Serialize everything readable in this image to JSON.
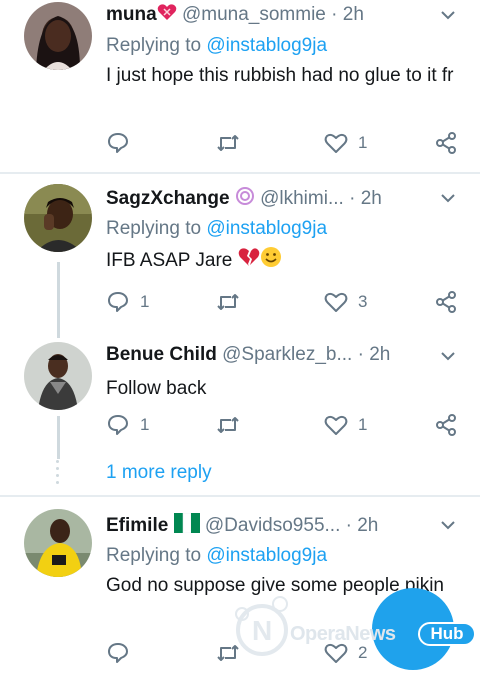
{
  "tweets": [
    {
      "name": "muna",
      "name_emoji": "heart-with-ribbon",
      "handle": "@muna_sommie",
      "time": "2h",
      "replying_prefix": "Replying to",
      "replying_to": "@instablog9ja",
      "text": "I just hope this rubbish had no glue to it fr",
      "reply_count": "",
      "retweet_count": "",
      "like_count": "1"
    },
    {
      "name": "SagzXchange",
      "name_emoji": "cyclone-swirl",
      "handle": "@lkhimi...",
      "time": "2h",
      "replying_prefix": "Replying to",
      "replying_to": "@instablog9ja",
      "text": "IFB ASAP Jare",
      "reply_count": "1",
      "retweet_count": "",
      "like_count": "3"
    },
    {
      "name": "Benue Child",
      "handle": "@Sparklez_b...",
      "time": "2h",
      "text": "Follow back",
      "reply_count": "1",
      "retweet_count": "",
      "like_count": "1"
    },
    {
      "name": "Efimile",
      "name_emoji": "nigeria-flag",
      "handle": "@Davidso955...",
      "time": "2h",
      "replying_prefix": "Replying to",
      "replying_to": "@instablog9ja",
      "text": "God no suppose give some people pikin",
      "reply_count": "",
      "retweet_count": "",
      "like_count": "2"
    }
  ],
  "more_reply": "1 more reply",
  "separator": "·",
  "watermark": {
    "text": "OperaNews",
    "badge": "Hub"
  },
  "colors": {
    "accent": "#1da1f2",
    "muted": "#657786",
    "divider": "#e6ecf0",
    "watermark": "#1fa2ec"
  }
}
